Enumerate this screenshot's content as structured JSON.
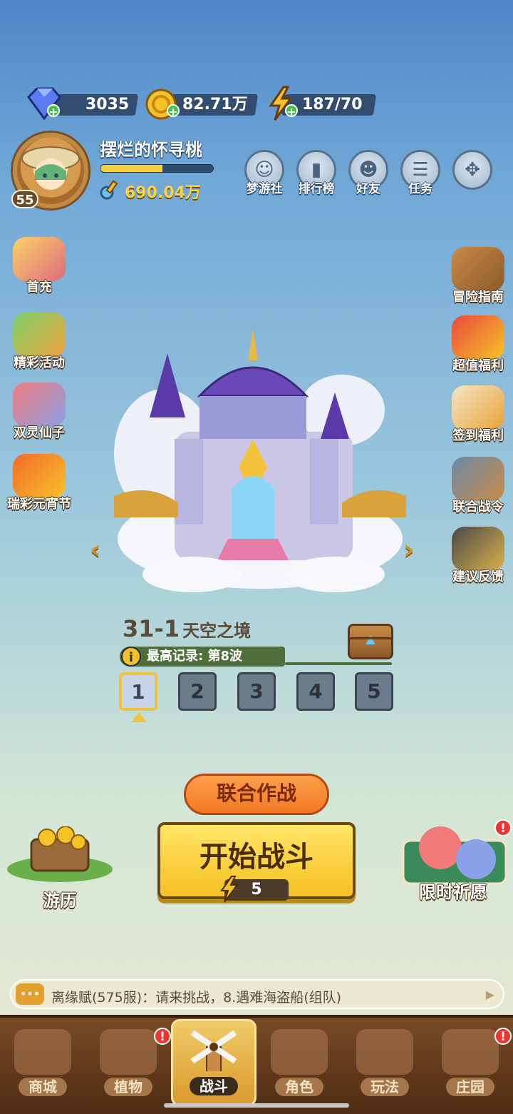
{
  "currency": {
    "gems": "3035",
    "gold": "82.71万",
    "energy": "187/70"
  },
  "profile": {
    "name": "摆烂的怀寻桃",
    "level": "55",
    "power": "690.04万",
    "xp_fraction": 0.55
  },
  "top_buttons": [
    {
      "label": "梦游社",
      "icon": "dream-club-icon"
    },
    {
      "label": "排行榜",
      "icon": "leaderboard-icon"
    },
    {
      "label": "好友",
      "icon": "friends-icon"
    },
    {
      "label": "任务",
      "icon": "tasks-icon"
    },
    {
      "label": "",
      "icon": "more-menu-icon"
    }
  ],
  "left_side": [
    {
      "label": "首充"
    },
    {
      "label": "精彩活动"
    },
    {
      "label": "双灵仙子"
    },
    {
      "label": "瑞彩元宵节"
    }
  ],
  "right_side": [
    {
      "label": "冒险指南"
    },
    {
      "label": "超值福利"
    },
    {
      "label": "签到福利"
    },
    {
      "label": "联合战令"
    },
    {
      "label": "建议反馈"
    }
  ],
  "level": {
    "id": "31-1",
    "name": "天空之境",
    "record": "最高记录: 第8波",
    "stages": [
      "1",
      "2",
      "3",
      "4",
      "5"
    ],
    "active_stage": 0
  },
  "actions": {
    "coop": "联合作战",
    "start": "开始战斗",
    "start_cost": "5",
    "travel": "游历",
    "wish": "限时祈愿"
  },
  "chat": {
    "message": "离缘赋(575服)：请来挑战，8.遇难海盗船(组队)"
  },
  "nav": [
    {
      "label": "商城",
      "badge": false
    },
    {
      "label": "植物",
      "badge": true
    },
    {
      "label": "战斗",
      "badge": false,
      "active": true
    },
    {
      "label": "角色",
      "badge": false
    },
    {
      "label": "玩法",
      "badge": false
    },
    {
      "label": "庄园",
      "badge": true
    }
  ],
  "colors": {
    "accent_gold": "#f5c021",
    "coop_orange": "#f07824",
    "badge_red": "#e33333"
  }
}
